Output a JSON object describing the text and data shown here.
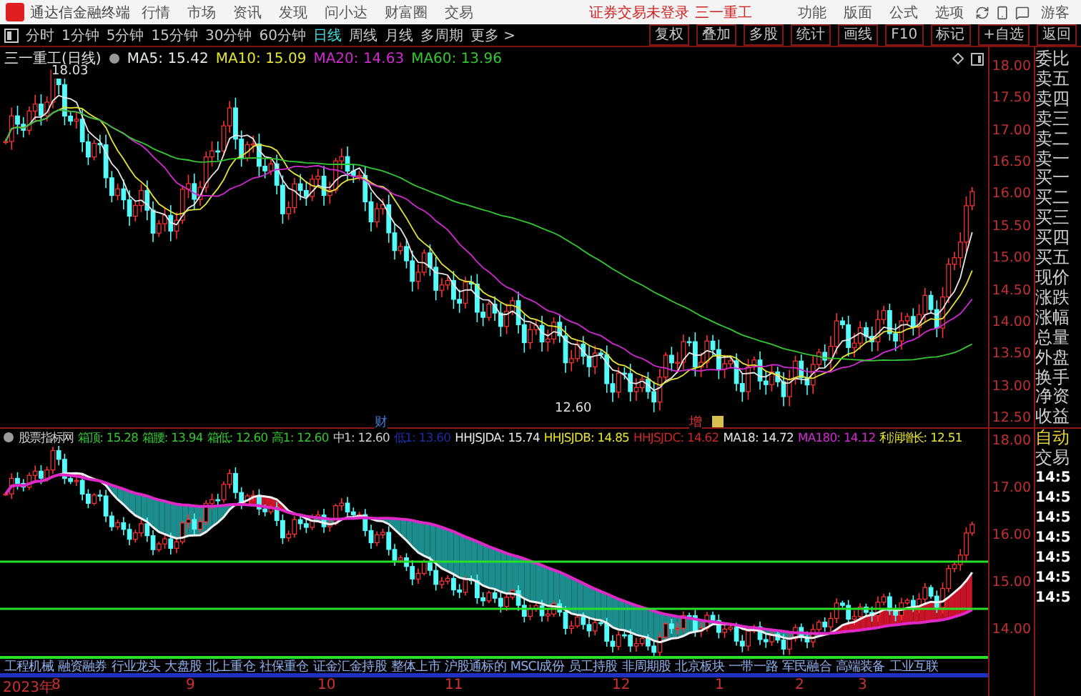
{
  "menu_bar": {
    "app_title": "通达信金融终端",
    "items": [
      "行情",
      "市场",
      "资讯",
      "发现",
      "问小达",
      "财富圈",
      "交易"
    ],
    "notice": "证券交易未登录",
    "stock": "三一重工",
    "tools": [
      "功能",
      "版面",
      "公式",
      "选项"
    ],
    "user": "游客"
  },
  "period_bar": {
    "periods": [
      {
        "label": "分时",
        "selected": false
      },
      {
        "label": "1分钟",
        "selected": false
      },
      {
        "label": "5分钟",
        "selected": false
      },
      {
        "label": "15分钟",
        "selected": false
      },
      {
        "label": "30分钟",
        "selected": false
      },
      {
        "label": "60分钟",
        "selected": false
      },
      {
        "label": "日线",
        "selected": true
      },
      {
        "label": "周线",
        "selected": false
      },
      {
        "label": "月线",
        "selected": false
      },
      {
        "label": "多周期",
        "selected": false
      },
      {
        "label": "更多 >",
        "selected": false
      }
    ],
    "actions": [
      "复权",
      "叠加",
      "多股",
      "统计",
      "画线",
      "F10",
      "标记",
      "+自选",
      "返回"
    ]
  },
  "main_chart": {
    "title": "三一重工(日线)",
    "ma": [
      {
        "label": "MA5: 15.42",
        "color": "#e8e8e8"
      },
      {
        "label": "MA10: 15.09",
        "color": "#e6e632"
      },
      {
        "label": "MA20: 14.63",
        "color": "#d428d4"
      },
      {
        "label": "MA60: 13.96",
        "color": "#32c832"
      }
    ],
    "high_label": "18.03",
    "low_label": "12.60",
    "markers": [
      {
        "label": "财",
        "color": "#4a7cd8"
      },
      {
        "label": "增",
        "color": "#e83030"
      }
    ]
  },
  "price_axis": [
    "18.00",
    "17.50",
    "17.00",
    "16.50",
    "16.00",
    "15.50",
    "15.00",
    "14.50",
    "14.00",
    "13.50",
    "13.00",
    "12.50"
  ],
  "indicator": {
    "title": "股票指标网",
    "values": [
      {
        "label": "箱顶: 15.28",
        "color": "#32c832"
      },
      {
        "label": "箱腰: 13.94",
        "color": "#32c832"
      },
      {
        "label": "箱低: 12.60",
        "color": "#32c832"
      },
      {
        "label": "高1: 12.60",
        "color": "#32c832"
      },
      {
        "label": "中1: 12.60",
        "color": "#d0d0d0"
      },
      {
        "label": "低1: 13.60",
        "color": "#1c2ca8"
      },
      {
        "label": "HHJSJDA: 15.74",
        "color": "#e8e8e8"
      },
      {
        "label": "HHJSJDB: 14.85",
        "color": "#e6e632"
      },
      {
        "label": "HHJSJDC: 14.62",
        "color": "#c82828"
      },
      {
        "label": "MA18: 14.72",
        "color": "#e8e8e8"
      },
      {
        "label": "MA180: 14.12",
        "color": "#d428d4"
      },
      {
        "label": "利润增长: 12.51",
        "color": "#e6e632"
      }
    ]
  },
  "indicator_axis": [
    "18.00",
    "17.00",
    "16.00",
    "15.00",
    "14.00"
  ],
  "quote_panel": {
    "labels": [
      "委比",
      "卖五",
      "卖四",
      "卖三",
      "卖二",
      "卖一",
      "买一",
      "买二",
      "买三",
      "买四",
      "买五",
      "现价",
      "涨跌",
      "涨幅",
      "总量",
      "外盘",
      "换手",
      "净资",
      "收益"
    ],
    "trade_labels": [
      "自动",
      "交易"
    ],
    "times": [
      "14:5",
      "14:5",
      "14:5",
      "14:5",
      "14:5",
      "14:5",
      "14:5"
    ]
  },
  "tags": [
    "工程机械",
    "融资融券",
    "行业龙头",
    "大盘股",
    "北上重仓",
    "社保重仓",
    "证金汇金持股",
    "整体上市",
    "沪股通标的",
    "MSCI成份",
    "员工持股",
    "非周期股",
    "北京板块",
    "一带一路",
    "军民融合",
    "高端装备",
    "工业互联"
  ],
  "date_axis": [
    "2023年",
    "8",
    "9",
    "10",
    "11",
    "12",
    "1",
    "2",
    "3"
  ]
}
